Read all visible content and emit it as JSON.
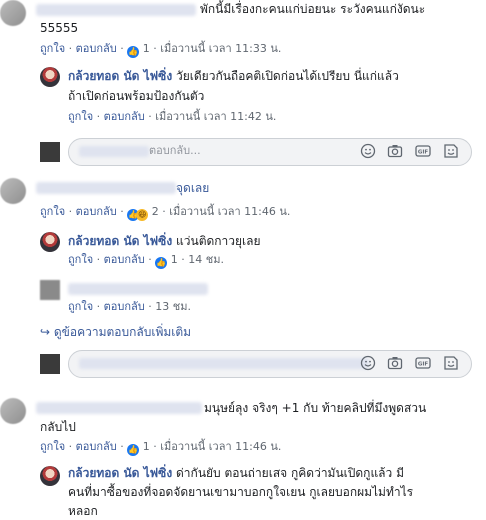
{
  "comments": [
    {
      "text_line1": "พักนี้มีเรื่องกะคนแก่บ่อยนะ ระวังคนแก่งัดนะ",
      "text_line2": "55555",
      "like": "ถูกใจ",
      "reply": "ตอบกลับ",
      "count": "1",
      "time": "เมื่อวานนี้ เวลา 11:33 น."
    },
    {
      "name": "กล้วยทอด นัด ไฟซิ่ง",
      "text_line1": "วัยเดียวกันถือคติเปิดก่อนได้เปรียบ นี่แก่แล้ว",
      "text_line2": "ถ้าเปิดก่อนพร้อมป้องกันตัว",
      "like": "ถูกใจ",
      "reply": "ตอบกลับ",
      "time": "เมื่อวานนี้ เวลา 11:42 น."
    },
    {
      "reply_placeholder": "ตอบกลับ..."
    },
    {
      "text_line1": "จุดเลย",
      "like": "ถูกใจ",
      "reply": "ตอบกลับ",
      "count": "2",
      "time": "เมื่อวานนี้ เวลา 11:46 น."
    },
    {
      "name": "กล้วยทอด นัด ไฟซิ่ง",
      "text_line1": "แว่นติดกาวยุเลย",
      "like": "ถูกใจ",
      "reply": "ตอบกลับ",
      "count": "1",
      "time": "14 ชม."
    },
    {
      "like": "ถูกใจ",
      "reply": "ตอบกลับ",
      "time": "13 ชม."
    },
    {
      "view_more": "ดูข้อความตอบกลับเพิ่มเติม"
    },
    {
      "text_line1": "มนุษย์ลุง จริงๆ +1 กับ ท้ายคลิปที่มึงพูดสวน",
      "text_line2": "กลับไป",
      "like": "ถูกใจ",
      "reply": "ตอบกลับ",
      "count": "1",
      "time": "เมื่อวานนี้ เวลา 11:46 น."
    },
    {
      "name": "กล้วยทอด นัด ไฟซิ่ง",
      "text_line1": "ด่ากันยับ ตอนถ่ายเสจ กูคิดว่ามันเปิดกูแล้ว มี",
      "text_line2": "คนที่มาซื้อของที่จอดจัดยานเขามาบอกกูใจเยน กูเลยบอกผมไม่ทำไร",
      "text_line3": "หลอก"
    }
  ],
  "icons": [
    "like-icon",
    "haha-icon",
    "emoji-icon",
    "camera-icon",
    "gif-icon",
    "sticker-icon",
    "reply-arrow-icon"
  ]
}
